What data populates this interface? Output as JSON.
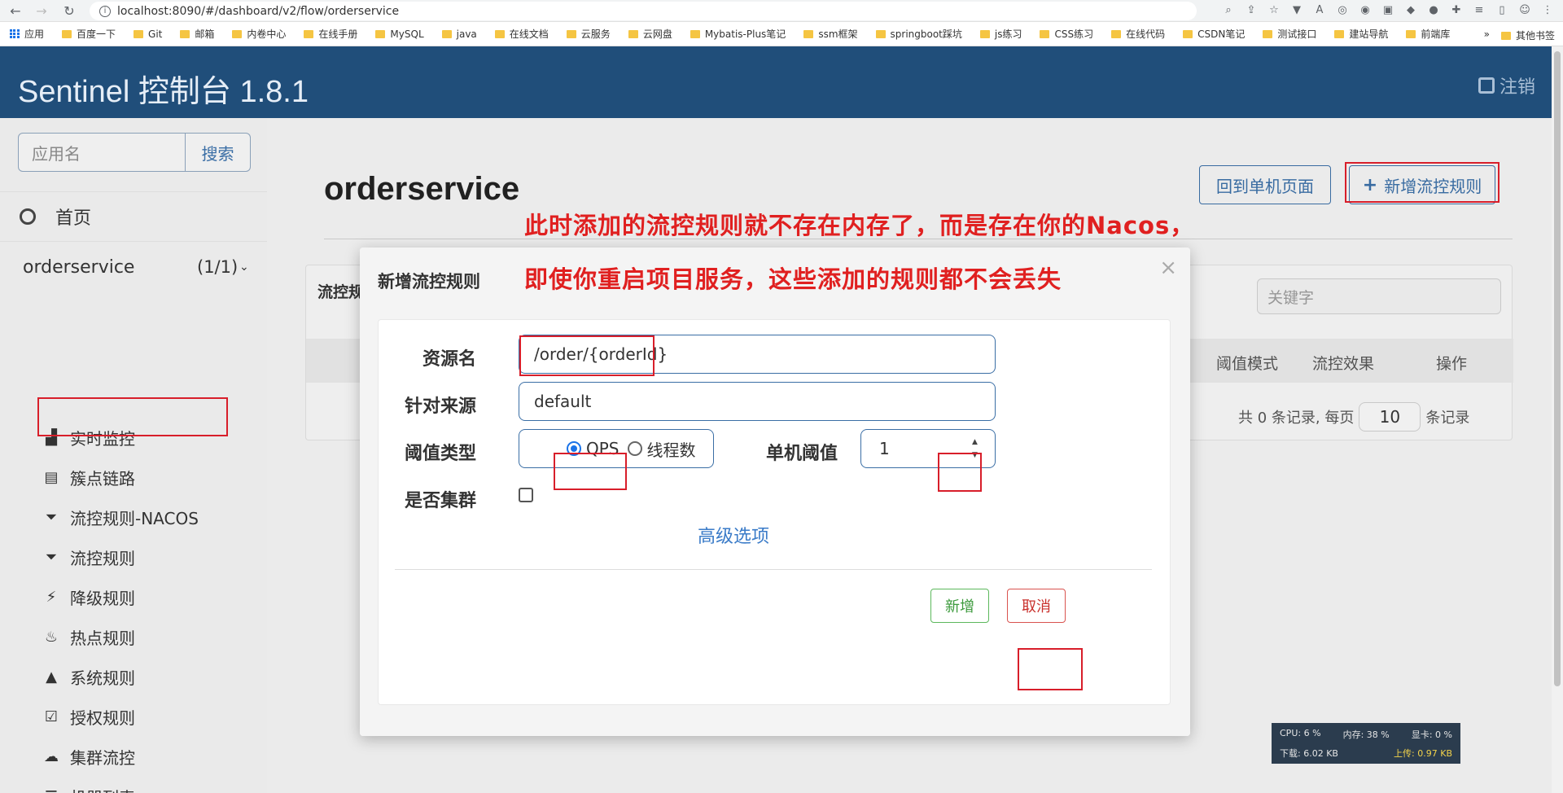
{
  "browser": {
    "url": "localhost:8090/#/dashboard/v2/flow/orderservice",
    "bookmarks": [
      "应用",
      "百度一下",
      "Git",
      "邮箱",
      "内卷中心",
      "在线手册",
      "MySQL",
      "java",
      "在线文档",
      "云服务",
      "云网盘",
      "Mybatis-Plus笔记",
      "ssm框架",
      "springboot踩坑",
      "js练习",
      "CSS练习",
      "在线代码",
      "CSDN笔记",
      "测试接口",
      "建站导航",
      "前端库"
    ],
    "bookmarks_more": "»",
    "other_bookmarks": "其他书签"
  },
  "app": {
    "title": "Sentinel 控制台 1.8.1",
    "logout": "注销"
  },
  "sidebar": {
    "search_placeholder": "应用名",
    "search_button": "搜索",
    "home": "首页",
    "app_name": "orderservice",
    "app_count": "(1/1)",
    "items": [
      {
        "label": "实时监控",
        "icon": "bar-chart-icon"
      },
      {
        "label": "簇点链路",
        "icon": "list-icon"
      },
      {
        "label": "流控规则-NACOS",
        "icon": "filter-icon"
      },
      {
        "label": "流控规则",
        "icon": "filter-icon"
      },
      {
        "label": "降级规则",
        "icon": "flash-icon"
      },
      {
        "label": "热点规则",
        "icon": "fire-icon"
      },
      {
        "label": "系统规则",
        "icon": "lock-icon"
      },
      {
        "label": "授权规则",
        "icon": "check-icon"
      },
      {
        "label": "集群流控",
        "icon": "cloud-icon"
      },
      {
        "label": "机器列表",
        "icon": "th-list-icon"
      }
    ]
  },
  "main": {
    "title": "orderservice",
    "back_button": "回到单机页面",
    "new_button": "新增流控规则",
    "panel_title": "流控规",
    "keyword_placeholder": "关键字",
    "columns": [
      "阈值模式",
      "流控效果",
      "操作"
    ],
    "pager": {
      "prefix": "共 0 条记录, 每页",
      "size": "10",
      "suffix": "条记录"
    }
  },
  "modal": {
    "title": "新增流控规则",
    "close": "×",
    "resource_label": "资源名",
    "resource_value": "/order/{orderId}",
    "origin_label": "针对来源",
    "origin_value": "default",
    "threshold_type_label": "阈值类型",
    "radio_qps": "QPS",
    "radio_threads": "线程数",
    "single_threshold_label": "单机阈值",
    "single_threshold_value": "1",
    "cluster_label": "是否集群",
    "advanced": "高级选项",
    "ok_button": "新增",
    "cancel_button": "取消"
  },
  "annotation": {
    "line1": "此时添加的流控规则就不存在内存了，而是存在你的Nacos，",
    "line2": "即使你重启项目服务，这些添加的规则都不会丢失"
  },
  "stats": {
    "cpu": "CPU: 6 %",
    "mem": "内存: 38 %",
    "gpu": "显卡: 0 %",
    "down": "下载: 6.02 KB",
    "up": "上传: 0.97 KB"
  },
  "colors": {
    "header": "#204e7a",
    "accent": "#3a6ea5",
    "annotation": "#e02020"
  }
}
